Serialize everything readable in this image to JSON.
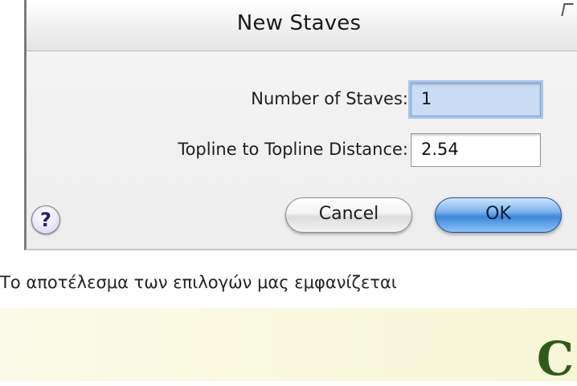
{
  "dialog": {
    "title": "New Staves",
    "fields": {
      "staves_label": "Number of Staves:",
      "staves_value": "1",
      "topline_label": "Topline to Topline Distance:",
      "topline_value": "2.54"
    },
    "help_label": "?",
    "help_icon": "question-mark-icon",
    "cancel_label": "Cancel",
    "ok_label": "OK"
  },
  "page": {
    "caption": "Το αποτέλεσμα των επιλογών μας εμφανίζεται",
    "bottom_glyph": "C"
  },
  "colors": {
    "focus_field": "#c9dcf4",
    "ok_button": "#3d86db",
    "glyph": "#2f5a1c"
  }
}
